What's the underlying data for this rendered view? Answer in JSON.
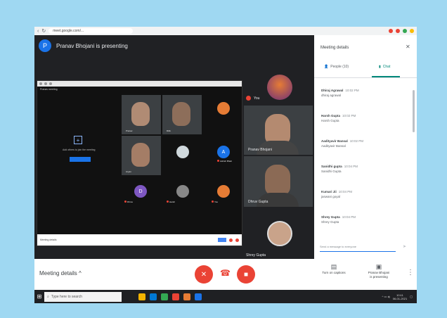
{
  "browser": {
    "url": "meet.google.com/...",
    "extension_colors": [
      "#ea4335",
      "#ea4335",
      "#34a853",
      "#fbbc04"
    ]
  },
  "presenting": {
    "avatar_letter": "P",
    "text": "Pranav Bhojani is presenting"
  },
  "shared_screen": {
    "inner_title": "Pranav meeting",
    "add_others_text": "Add others to join the meeting",
    "participant_tiles": [
      {
        "label": "Pranav"
      },
      {
        "label": "Ritik"
      },
      {
        "label": "Aryan"
      }
    ],
    "round_avatars": [
      {
        "letter": "A",
        "color": "#1a73e8",
        "label": "Ashish Bhatt"
      },
      {
        "letter": "D",
        "color": "#7e57c2",
        "label": "Dhruv"
      },
      {
        "letter": "",
        "color": "#888888",
        "label": "Harsh"
      },
      {
        "letter": "",
        "color": "#e67c35",
        "label": "You"
      }
    ],
    "bottom_label": "Meeting details"
  },
  "meet_participants": {
    "you_label": "You",
    "tiles": [
      {
        "name": "Pranav Bhojani"
      },
      {
        "name": "Dhruv Gupta"
      }
    ],
    "self_name": "Shrey Gupta"
  },
  "controls": {
    "meeting_details": "Meeting details",
    "mic_icon": "mic-off-icon",
    "camera_icon": "camera-off-icon",
    "hangup_icon": "phone-hangup-icon",
    "captions": "Turn on captions",
    "presenting_line1": "Pranav Bhojani",
    "presenting_line2": "is presenting"
  },
  "taskbar": {
    "search_placeholder": "Type here to search",
    "time": "10:11",
    "date": "06-01-2021",
    "icon_colors": [
      "#f4b400",
      "#0078d4",
      "#34a853",
      "#ea4335",
      "#e67c35",
      "#1a73e8"
    ]
  },
  "panel": {
    "title": "Meeting details",
    "tab_people": "People (10)",
    "tab_chat": "Chat",
    "input_placeholder": "Send a message to everyone",
    "messages": [
      {
        "name": "Dhiraj Agrawal",
        "time": "10:02 PM",
        "text": "dhiraj agrawal"
      },
      {
        "name": "Harsh Gupta",
        "time": "10:02 PM",
        "text": "Harsh Gupta"
      },
      {
        "name": "Aadityavir Bansal",
        "time": "10:02 PM",
        "text": "Aadityavir Bansal"
      },
      {
        "name": "Sanidhi gupta",
        "time": "10:04 PM",
        "text": "Sanidhi Gupta"
      },
      {
        "name": "Kumari Jii",
        "time": "10:04 PM",
        "text": "jaswani goyal"
      },
      {
        "name": "Shrey Gupta",
        "time": "10:04 PM",
        "text": "Shrey Gupta"
      }
    ]
  }
}
